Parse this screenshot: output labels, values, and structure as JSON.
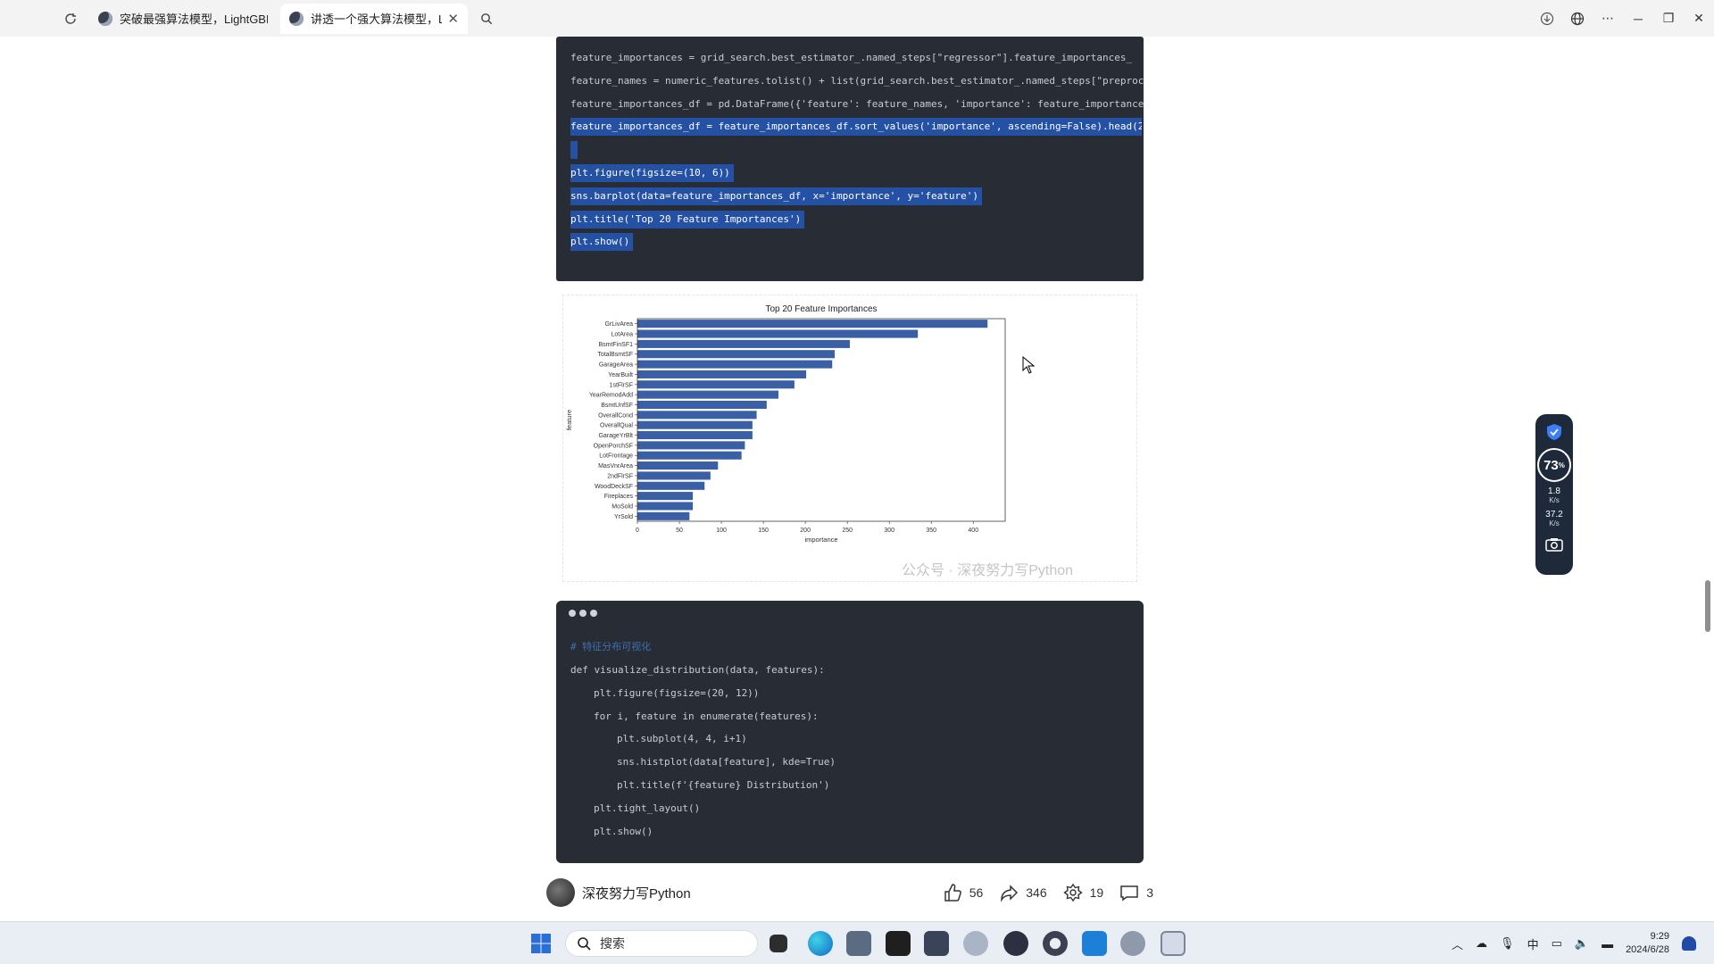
{
  "browser": {
    "tabs": [
      {
        "title": "突破最强算法模型，LightGBM！",
        "active": false
      },
      {
        "title": "讲透一个强大算法模型，LightGBM",
        "active": true
      }
    ],
    "refresh_icon": "refresh-icon",
    "close_icon": "close-icon",
    "search_icon": "search-icon"
  },
  "code_top": {
    "lines": [
      {
        "text": "feature_importances = grid_search.best_estimator_.named_steps[\"regressor\"].feature_importances_",
        "selected": false
      },
      {
        "text": "feature_names = numeric_features.tolist() + list(grid_search.best_estimator_.named_steps[\"preproc",
        "selected": false
      },
      {
        "text": "feature_importances_df = pd.DataFrame({'feature': feature_names, 'importance': feature_importance",
        "selected": false
      },
      {
        "text": "feature_importances_df = feature_importances_df.sort_values('importance', ascending=False).head(2",
        "selected": true
      },
      {
        "text": "",
        "selected": true
      },
      {
        "text": "plt.figure(figsize=(10, 6))",
        "selected": true
      },
      {
        "text": "sns.barplot(data=feature_importances_df, x='importance', y='feature')",
        "selected": true
      },
      {
        "text": "plt.title('Top 20 Feature Importances')",
        "selected": true
      },
      {
        "text": "plt.show()",
        "selected": true
      }
    ]
  },
  "chart_data": {
    "type": "bar",
    "orientation": "horizontal",
    "title": "Top 20 Feature Importances",
    "xlabel": "importance",
    "ylabel": "feature",
    "categories": [
      "GrLivArea",
      "LotArea",
      "BsmtFinSF1",
      "TotalBsmtSF",
      "GarageArea",
      "YearBuilt",
      "1stFlrSF",
      "YearRemodAdd",
      "BsmtUnfSF",
      "OverallCond",
      "OverallQual",
      "GarageYrBlt",
      "OpenPorchSF",
      "LotFrontage",
      "MasVnrArea",
      "2ndFlrSF",
      "WoodDeckSF",
      "Fireplaces",
      "MoSold",
      "YrSold"
    ],
    "values": [
      417,
      334,
      253,
      235,
      232,
      201,
      187,
      168,
      154,
      142,
      137,
      137,
      128,
      124,
      96,
      87,
      80,
      66,
      66,
      62
    ],
    "xlim": [
      0,
      438
    ],
    "xticks": [
      0,
      50,
      100,
      150,
      200,
      250,
      300,
      350,
      400
    ],
    "bar_color": "#3a5fa4",
    "grid": false
  },
  "watermark": "公众号 · 深夜努力写Python",
  "code_bottom": {
    "comment": "# 特征分布可视化",
    "lines": [
      {
        "indent": 0,
        "text": "def visualize_distribution(data, features):"
      },
      {
        "indent": 1,
        "text": "plt.figure(figsize=(20, 12))"
      },
      {
        "indent": 1,
        "text": "for i, feature in enumerate(features):"
      },
      {
        "indent": 2,
        "text": "plt.subplot(4, 4, i+1)"
      },
      {
        "indent": 2,
        "text": "sns.histplot(data[feature], kde=True)"
      },
      {
        "indent": 2,
        "text": "plt.title(f'{feature} Distribution')"
      },
      {
        "indent": 1,
        "text": "plt.tight_layout()"
      },
      {
        "indent": 1,
        "text": "plt.show()"
      }
    ]
  },
  "author": {
    "name": "深夜努力写Python",
    "likes": "56",
    "shares": "346",
    "recommends": "19",
    "comments": "3"
  },
  "widget": {
    "percent": "73",
    "percent_unit": "%",
    "upload_speed": "1.8",
    "download_speed": "37.2",
    "speed_unit": "K/s"
  },
  "taskbar": {
    "search_placeholder": "搜索",
    "ime": "中",
    "time": "9:29",
    "date": "2024/6/28"
  }
}
